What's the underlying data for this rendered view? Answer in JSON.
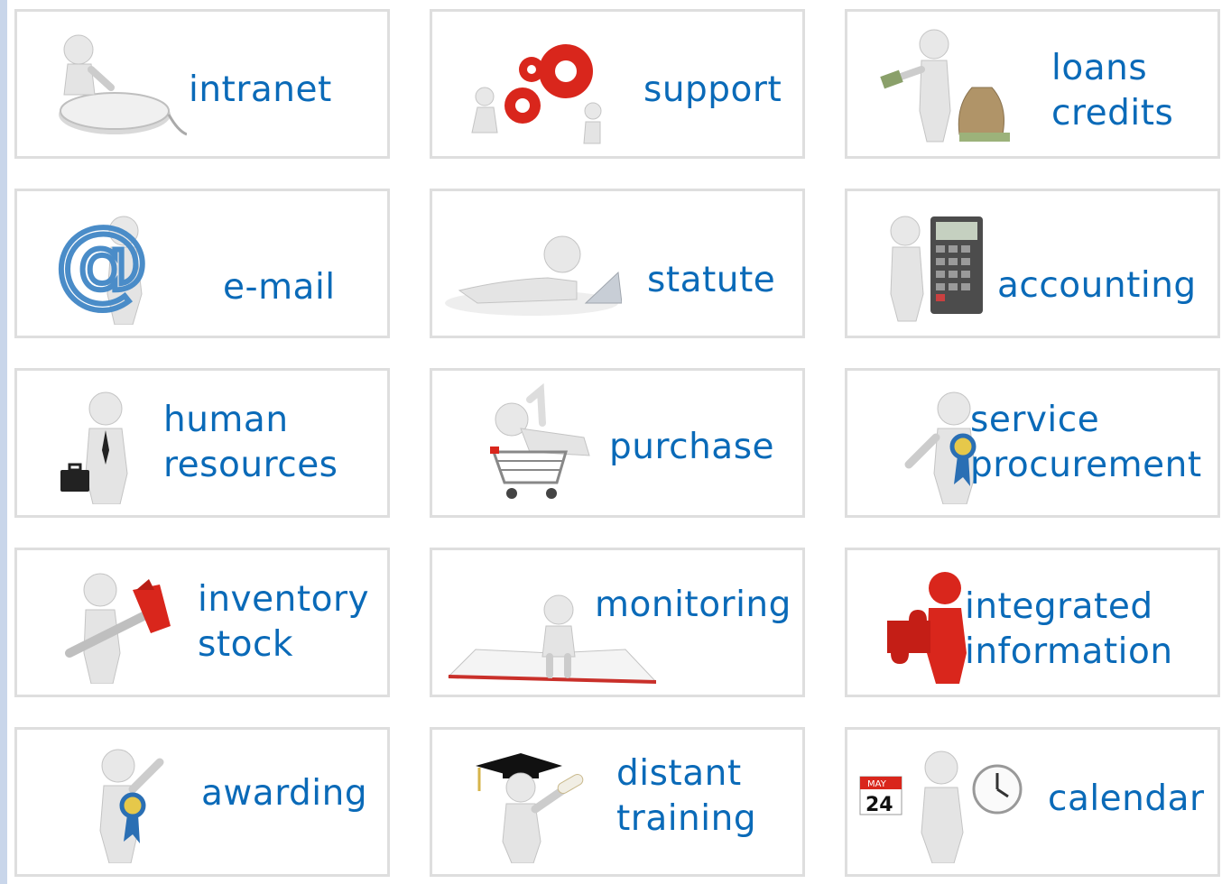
{
  "tiles": [
    {
      "id": "intranet",
      "lines": [
        "intranet"
      ],
      "icon": "mouse-figure-icon"
    },
    {
      "id": "support",
      "lines": [
        "support"
      ],
      "icon": "gears-figure-icon"
    },
    {
      "id": "loans-credits",
      "lines": [
        "loans",
        "credits"
      ],
      "icon": "money-bag-figure-icon"
    },
    {
      "id": "e-mail",
      "lines": [
        "e-mail"
      ],
      "icon": "at-sign-figure-icon"
    },
    {
      "id": "statute",
      "lines": [
        "statute"
      ],
      "icon": "laptop-figure-icon"
    },
    {
      "id": "accounting",
      "lines": [
        "accounting"
      ],
      "icon": "calculator-figure-icon"
    },
    {
      "id": "human-resources",
      "lines": [
        "human",
        "resources"
      ],
      "icon": "briefcase-figure-icon"
    },
    {
      "id": "purchase",
      "lines": [
        "purchase"
      ],
      "icon": "shopping-cart-figure-icon"
    },
    {
      "id": "service-procurement",
      "lines": [
        "service",
        "procurement"
      ],
      "icon": "ribbon-figure-icon"
    },
    {
      "id": "inventory-stock",
      "lines": [
        "inventory",
        "stock"
      ],
      "icon": "wrench-figure-icon"
    },
    {
      "id": "monitoring",
      "lines": [
        "monitoring"
      ],
      "icon": "book-figure-icon"
    },
    {
      "id": "integrated-information",
      "lines": [
        "integrated",
        "information"
      ],
      "icon": "puzzle-figure-icon"
    },
    {
      "id": "awarding",
      "lines": [
        "awarding"
      ],
      "icon": "medal-figure-icon"
    },
    {
      "id": "distant-training",
      "lines": [
        "distant",
        "training"
      ],
      "icon": "graduate-figure-icon"
    },
    {
      "id": "calendar",
      "lines": [
        "calendar"
      ],
      "icon": "calendar-clock-figure-icon",
      "calendar_month": "MAY",
      "calendar_day": "24"
    }
  ],
  "colors": {
    "label": "#0a6ab8",
    "accent_red": "#d9261c",
    "figure": "#e6e6e6",
    "tile_border": "#dedede"
  }
}
